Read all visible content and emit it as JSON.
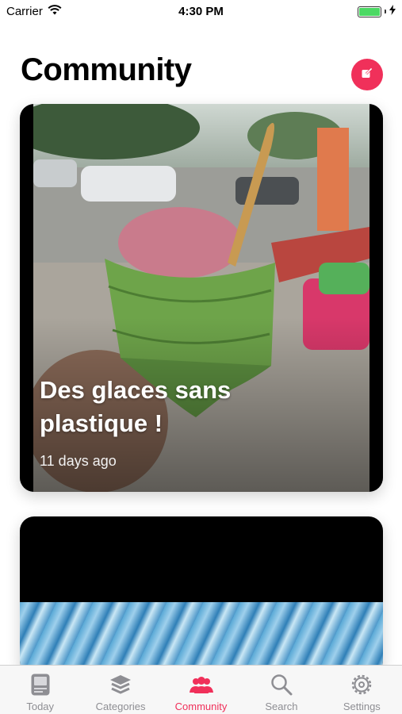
{
  "status_bar": {
    "carrier": "Carrier",
    "time": "4:30 PM"
  },
  "header": {
    "title": "Community",
    "compose_icon": "compose-icon"
  },
  "cards": [
    {
      "title": "Des glaces sans plastique !",
      "date": "11 days ago"
    },
    {
      "title": "",
      "date": ""
    }
  ],
  "tabs": [
    {
      "label": "Today",
      "icon": "today-icon",
      "active": false
    },
    {
      "label": "Categories",
      "icon": "layers-icon",
      "active": false
    },
    {
      "label": "Community",
      "icon": "people-icon",
      "active": true
    },
    {
      "label": "Search",
      "icon": "search-icon",
      "active": false
    },
    {
      "label": "Settings",
      "icon": "gear-icon",
      "active": false
    }
  ],
  "colors": {
    "accent": "#f0305a",
    "battery": "#4cd964",
    "inactive_tab": "#8e8e93"
  }
}
